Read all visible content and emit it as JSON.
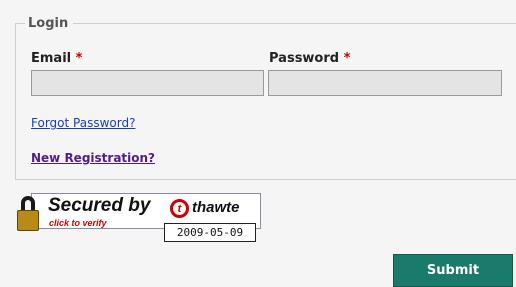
{
  "form": {
    "legend": "Login",
    "email": {
      "label": "Email",
      "required_mark": "*",
      "value": ""
    },
    "password": {
      "label": "Password",
      "required_mark": "*",
      "value": ""
    },
    "forgot_link": "Forgot Password?",
    "new_registration_link": "New Registration?",
    "submit_label": "Submit"
  },
  "seal": {
    "title": "Secured by",
    "subtitle": "click to verify",
    "brand_mark": "t",
    "brand": "thawte",
    "date": "2009-05-09",
    "icon": "padlock-icon"
  },
  "colors": {
    "required": "#cc0000",
    "link": "#1a3fb0",
    "visited_link": "#551a8b",
    "submit_bg": "#1a7a6b"
  }
}
